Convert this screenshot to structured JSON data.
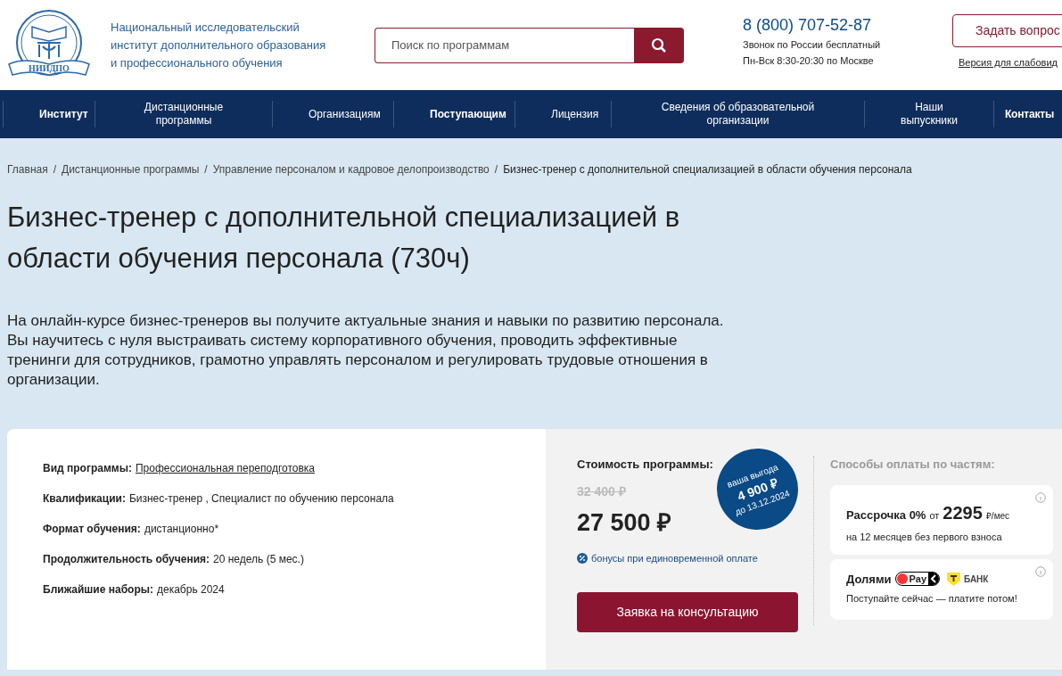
{
  "header": {
    "org_name": [
      "Национальный исследовательский",
      "институт дополнительного образования",
      "и профессионального обучения"
    ],
    "logo_text": "НИИДПО",
    "search": {
      "placeholder": "Поиск по программам"
    },
    "phone": "8 (800) 707-52-87",
    "phone_notes": [
      "Звонок по России бесплатный",
      "Пн-Вск 8:30-20:30 по Москве"
    ],
    "ask_button": "Задать вопрос",
    "accessibility_link": "Версия для слабовид"
  },
  "nav": [
    {
      "label": "Институт",
      "bold": true
    },
    {
      "label": "Дистанционные программы",
      "bold": false
    },
    {
      "label": "Организациям",
      "bold": false
    },
    {
      "label": "Поступающим",
      "bold": true
    },
    {
      "label": "Лицензия",
      "bold": false
    },
    {
      "label": "Сведения об образовательной организации",
      "bold": false
    },
    {
      "label": "Наши выпускники",
      "bold": false
    },
    {
      "label": "Контакты",
      "bold": true
    }
  ],
  "breadcrumbs": {
    "separator": "/",
    "items": [
      "Главная",
      "Дистанционные программы",
      "Управление персоналом и кадровое делопроизводство",
      "Бизнес-тренер с дополнительной специализацией в области обучения персонала"
    ]
  },
  "title": "Бизнес-тренер с дополнительной специализацией в области обучения персонала (730ч)",
  "description": [
    "На онлайн-курсе бизнес-тренеров вы получите актуальные знания и навыки по развитию персонала.",
    "Вы научитесь с нуля выстраивать систему корпоративного обучения, проводить эффективные тренинги для сотрудников, грамотно управлять персоналом и регулировать трудовые отношения в организации."
  ],
  "details": [
    {
      "label": "Вид программы:",
      "value": "Профессиональная переподготовка",
      "kind": "link"
    },
    {
      "label": "Квалификации:",
      "value": "Бизнес-тренер , Специалист по обучению персонала",
      "kind": "text"
    },
    {
      "label": "Формат обучения:",
      "value": "дистанционно*",
      "kind": "text"
    },
    {
      "label": "Продолжительность обучения:",
      "value": "20 недель (5 мес.)",
      "kind": "text"
    },
    {
      "label": "Ближайшие наборы:",
      "value": "декабрь 2024",
      "kind": "text"
    }
  ],
  "price": {
    "heading": "Стоимость программы:",
    "old_price": "32 400 ₽",
    "price": "27 500 ₽",
    "badge": [
      "ваша выгода",
      "4 900 ₽",
      "до 13.12.2024"
    ],
    "bonus_link": "бонусы при единовременной оплате",
    "cta": "Заявка на консультацию"
  },
  "installments": {
    "heading": "Способы оплаты по частям:",
    "cards": [
      {
        "kind": "installment",
        "title": "Рассрочка 0%",
        "from": "от",
        "amount": "2295",
        "unit": "₽/мес",
        "note": "на 12 месяцев без первого взноса"
      },
      {
        "kind": "dolyami",
        "title": "Долями",
        "pay_label": "Pay",
        "bank_label": "БАНК",
        "note": "Поступайте сейчас — платите потом!"
      }
    ]
  }
}
